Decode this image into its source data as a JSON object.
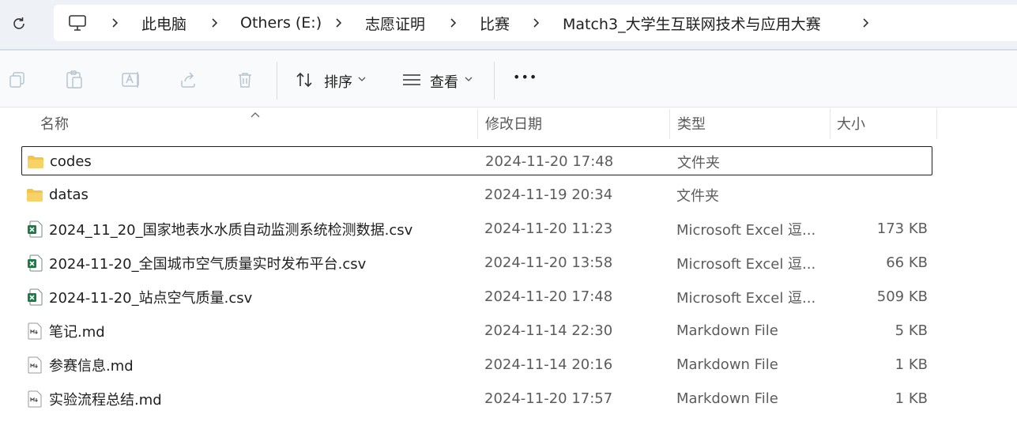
{
  "breadcrumb": {
    "items": [
      "此电脑",
      "Others (E:)",
      "志愿证明",
      "比赛",
      "Match3_大学生互联网技术与应用大赛"
    ]
  },
  "toolbar": {
    "sort_label": "排序",
    "view_label": "查看",
    "more_label": "•••"
  },
  "columns": {
    "name": "名称",
    "modified": "修改日期",
    "type": "类型",
    "size": "大小"
  },
  "files": [
    {
      "name": "codes",
      "modified": "2024-11-20 17:48",
      "type": "文件夹",
      "size": "",
      "icon": "folder-icon"
    },
    {
      "name": "datas",
      "modified": "2024-11-19 20:34",
      "type": "文件夹",
      "size": "",
      "icon": "folder-icon"
    },
    {
      "name": "2024_11_20_国家地表水水质自动监测系统检测数据.csv",
      "modified": "2024-11-20 11:23",
      "type": "Microsoft Excel 逗...",
      "size": "173 KB",
      "icon": "excel-icon"
    },
    {
      "name": "2024-11-20_全国城市空气质量实时发布平台.csv",
      "modified": "2024-11-20 13:58",
      "type": "Microsoft Excel 逗...",
      "size": "66 KB",
      "icon": "excel-icon"
    },
    {
      "name": "2024-11-20_站点空气质量.csv",
      "modified": "2024-11-20 17:48",
      "type": "Microsoft Excel 逗...",
      "size": "509 KB",
      "icon": "excel-icon"
    },
    {
      "name": "笔记.md",
      "modified": "2024-11-14 22:30",
      "type": "Markdown File",
      "size": "5 KB",
      "icon": "markdown-icon"
    },
    {
      "name": "参赛信息.md",
      "modified": "2024-11-14 20:16",
      "type": "Markdown File",
      "size": "1 KB",
      "icon": "markdown-icon"
    },
    {
      "name": "实验流程总结.md",
      "modified": "2024-11-20 17:57",
      "type": "Markdown File",
      "size": "1 KB",
      "icon": "markdown-icon"
    }
  ],
  "colors": {
    "folder": "#f4c542",
    "excel": "#1d7a45",
    "accent": "#1f1f1f"
  }
}
